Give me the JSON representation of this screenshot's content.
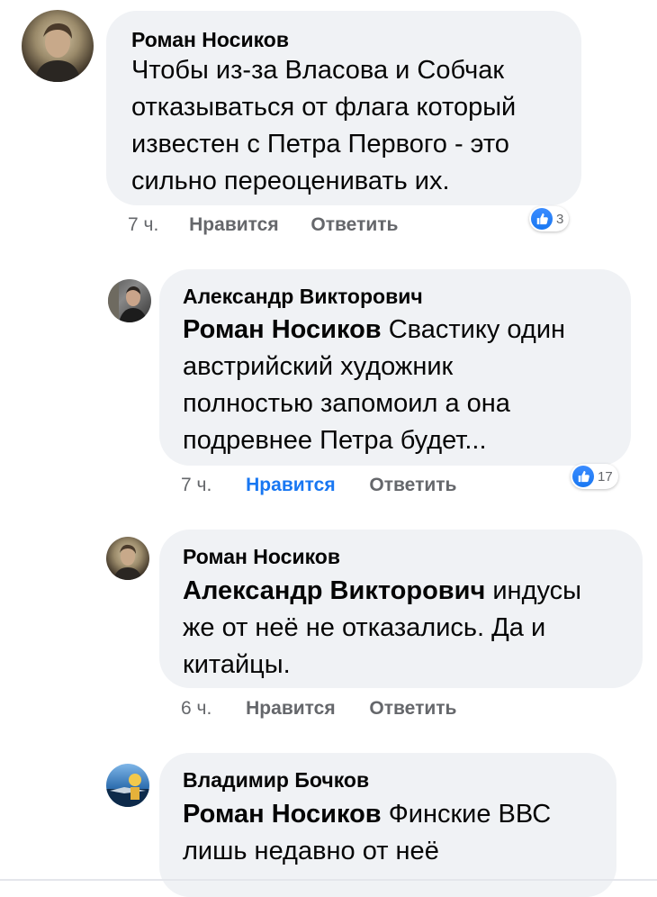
{
  "comments": [
    {
      "author": "Роман Носиков",
      "mention": "",
      "lines": [
        "Чтобы из-за Власова и Собчак",
        "отказываться от флага который",
        "известен с Петра Первого - это",
        "сильно переоценивать их."
      ],
      "time": "7 ч.",
      "like_label": "Нравится",
      "reply_label": "Ответить",
      "reaction_count": "3",
      "liked": false
    },
    {
      "author": "Александр Викторович",
      "mention": "Роман Носиков",
      "lines": [
        "Свастику один",
        "австрийский художник",
        "полностью запомоил а она",
        "подревнее Петра будет..."
      ],
      "time": "7 ч.",
      "like_label": "Нравится",
      "reply_label": "Ответить",
      "reaction_count": "17",
      "liked": true
    },
    {
      "author": "Роман Носиков",
      "mention": "Александр Викторович",
      "lines": [
        "индусы",
        "же от неё не отказались. Да и",
        "китайцы."
      ],
      "time": "6 ч.",
      "like_label": "Нравится",
      "reply_label": "Ответить",
      "reaction_count": "",
      "liked": false
    },
    {
      "author": "Владимир Бочков",
      "mention": "Роман Носиков",
      "lines": [
        "Финские ВВС",
        "лишь недавно от неё"
      ],
      "time": "",
      "like_label": "",
      "reply_label": "",
      "reaction_count": "",
      "liked": false
    }
  ],
  "colors": {
    "bubble": "#f0f2f5",
    "meta": "#65676b",
    "accent": "#1877f2",
    "text": "#050505"
  }
}
